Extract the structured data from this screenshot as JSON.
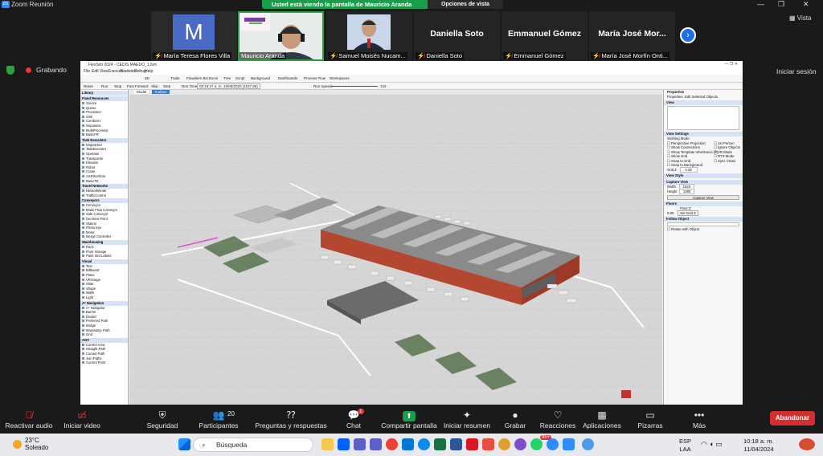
{
  "window": {
    "title": "Zoom Reunión",
    "minimize": "—",
    "maximize": "❐",
    "close": "✕"
  },
  "share_banner": {
    "message": "Usted está viendo la pantalla de Mauricio Aranda",
    "options_label": "Opciones de vista"
  },
  "participants": [
    {
      "name": "María Teresa Flores Villa",
      "avatar_letter": "M",
      "muted": true,
      "video": "avatar",
      "avatar_color": "#4a6bc4"
    },
    {
      "name": "Mauricio Aranda",
      "muted": false,
      "video": "camera"
    },
    {
      "name": "Samuel Moisés Nucam...",
      "muted": true,
      "video": "photo"
    },
    {
      "name": "Daniella Soto",
      "display": "Daniella Soto",
      "muted": true,
      "video": "off"
    },
    {
      "name": "Emmanuel Gómez",
      "display": "Emmanuel Gómez",
      "muted": true,
      "video": "off"
    },
    {
      "name": "María José Morfín Onti...",
      "display": "María José Mor...",
      "muted": true,
      "video": "off"
    }
  ],
  "view_label": "Vista",
  "recording_label": "Grabando",
  "signin_label": "Iniciar sesión",
  "shared_app": {
    "title": "FlexSim 2024 - CEDIS MAEDO_1.fsm",
    "menu": [
      "File",
      "Edit",
      "View",
      "Execute",
      "Statistics",
      "Debug",
      "Help"
    ],
    "toolbar": [
      "3D",
      "Trade",
      "Flowdiem Bin",
      "Excel",
      "Tree",
      "Script",
      "Background",
      "Dashboards",
      "Process Flow",
      "Workspaces"
    ],
    "run_controls": [
      "Reset",
      "Run",
      "Stop",
      "Fast Forward",
      "Skip",
      "Step"
    ],
    "run_time_label": "Run Time:",
    "run_time": "08:19:27 a. m.  18/06/2020  (1167.85)",
    "run_speed_label": "Run Speed:",
    "run_speed": "722",
    "library_title": "Library",
    "library_groups": [
      {
        "name": "Fixed Resources",
        "items": [
          "Source",
          "Queue",
          "Processor",
          "Sink",
          "Combiner",
          "Separator",
          "MultiProcessor",
          "BasicFR"
        ]
      },
      {
        "name": "Task Executers",
        "items": [
          "Dispatcher",
          "TaskExecuter",
          "Operator",
          "Transporter",
          "Elevator",
          "Robot",
          "Crane",
          "ASRSvehicle",
          "BasicTE"
        ]
      },
      {
        "name": "Travel Networks",
        "items": [
          "NetworkNode",
          "TrafficControl"
        ]
      },
      {
        "name": "Conveyors",
        "items": [
          "Conveyor",
          "Mass Flow Conveyor",
          "Side Conveyor",
          "Decision Point",
          "Station",
          "Photo Eye",
          "Motor",
          "Merge Controller"
        ]
      },
      {
        "name": "Warehousing",
        "items": [
          "Rack",
          "Floor Storage",
          "Paint Slot Labels"
        ]
      },
      {
        "name": "Visual",
        "items": [
          "Text",
          "Billboard",
          "Plane",
          "VR/Stage",
          "Slide",
          "Shape",
          "Walls",
          "Light"
        ]
      },
      {
        "name": "A* Navigation",
        "items": [
          "A* Navigator",
          "Barrier",
          "Divider",
          "Preferred Path",
          "Bridge",
          "Mandatory Path",
          "Grid"
        ]
      },
      {
        "name": "AGV",
        "items": [
          "Control Area",
          "Straight Path",
          "Curved Path",
          "Join Paths",
          "Control Point"
        ]
      }
    ],
    "view_tabs": [
      "Model",
      "Toolbox"
    ],
    "properties": {
      "title": "Properties",
      "tabs": [
        "Properties",
        "Edit Selected Objects"
      ],
      "view_header": "View",
      "view_settings": "View Settings",
      "working_mode": "Working Mode",
      "options_left": [
        "Perspective Projection",
        "Show Connections",
        "Show Template Inheritance (T)",
        "Show Grid",
        "Snap to Grid",
        "Snap to Background"
      ],
      "options_right": [
        "1st Person",
        "Ignore Objects",
        "VR Mode",
        "RTX Mode",
        "Sync Views"
      ],
      "grid_z_label": "Grid Z",
      "grid_z": "0.00",
      "view_style": "View Style",
      "capture_view": "Capture View",
      "width_label": "Width",
      "width": "1920",
      "height_label": "Height",
      "height": "1080",
      "capture_button": "Capture View",
      "floors": "Floors",
      "floor_name": "Floor Z",
      "floor_value": "0.00",
      "floor_button": "Set Grid Z",
      "follow_object": "Follow Object",
      "rotate_label": "Rotate with Object"
    }
  },
  "controls": [
    {
      "label": "Reactivar audio",
      "icon": "mic-off-icon"
    },
    {
      "label": "Iniciar video",
      "icon": "video-off-icon"
    },
    {
      "label": "Seguridad",
      "icon": "shield-icon"
    },
    {
      "label": "Participantes",
      "icon": "people-icon",
      "count": "20"
    },
    {
      "label": "Preguntas y respuestas",
      "icon": "qa-icon"
    },
    {
      "label": "Chat",
      "icon": "chat-icon",
      "badge": "1"
    },
    {
      "label": "Compartir pantalla",
      "icon": "share-icon"
    },
    {
      "label": "Iniciar resumen",
      "icon": "summary-icon"
    },
    {
      "label": "Grabar",
      "icon": "record-icon"
    },
    {
      "label": "Reacciones",
      "icon": "heart-icon"
    },
    {
      "label": "Aplicaciones",
      "icon": "apps-icon"
    },
    {
      "label": "Pizarras",
      "icon": "whiteboard-icon"
    },
    {
      "label": "Más",
      "icon": "more-icon"
    }
  ],
  "leave_label": "Abandonar",
  "taskbar": {
    "weather_temp": "23°C",
    "weather_desc": "Soleado",
    "search_placeholder": "Búsqueda",
    "lang_top": "ESP",
    "lang_bottom": "LAA",
    "time": "10:18 a. m.",
    "date": "11/04/2024",
    "badge_99": "99+"
  },
  "colors": {
    "zoom_green": "#1b9e4b",
    "leave_red": "#d32f2f",
    "accent_blue": "#1f6feb",
    "muted_red": "#e8383d"
  }
}
